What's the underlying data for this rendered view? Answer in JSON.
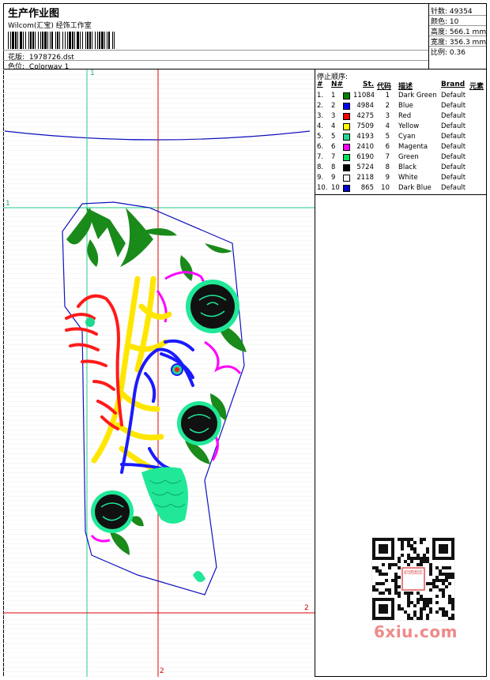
{
  "header": {
    "title": "生产作业图",
    "subtitle": "Wilcom(汇宝) 经饰工作室",
    "design_label": "花版:",
    "design_value": "1978726.dst",
    "colorway_label": "色位:",
    "colorway_value": "Colorway 1"
  },
  "stats": [
    {
      "label": "针数:",
      "value": "49354"
    },
    {
      "label": "颜色:",
      "value": "10"
    },
    {
      "label": "高度:",
      "value": "566.1 mm"
    },
    {
      "label": "宽度:",
      "value": "356.3 mm"
    },
    {
      "label": "比例:",
      "value": "0.36"
    }
  ],
  "sequence": {
    "label": "停止顺序:",
    "columns": [
      "#",
      "N#",
      "St.",
      "代码",
      "描述",
      "Brand",
      "元素"
    ],
    "rows": [
      {
        "num": "1.",
        "n": "1",
        "color": "#008000",
        "st": "11084",
        "code": "1",
        "desc": "Dark Green",
        "brand": "Default"
      },
      {
        "num": "2.",
        "n": "2",
        "color": "#0000ff",
        "st": "4984",
        "code": "2",
        "desc": "Blue",
        "brand": "Default"
      },
      {
        "num": "3.",
        "n": "3",
        "color": "#ff0000",
        "st": "4275",
        "code": "3",
        "desc": "Red",
        "brand": "Default"
      },
      {
        "num": "4.",
        "n": "4",
        "color": "#ffff00",
        "st": "7509",
        "code": "4",
        "desc": "Yellow",
        "brand": "Default"
      },
      {
        "num": "5.",
        "n": "5",
        "color": "#20d890",
        "st": "4193",
        "code": "5",
        "desc": "Cyan",
        "brand": "Default"
      },
      {
        "num": "6.",
        "n": "6",
        "color": "#ff00ff",
        "st": "2410",
        "code": "6",
        "desc": "Magenta",
        "brand": "Default"
      },
      {
        "num": "7.",
        "n": "7",
        "color": "#00e060",
        "st": "6190",
        "code": "7",
        "desc": "Green",
        "brand": "Default"
      },
      {
        "num": "8.",
        "n": "8",
        "color": "#000000",
        "st": "5724",
        "code": "8",
        "desc": "Black",
        "brand": "Default"
      },
      {
        "num": "9.",
        "n": "9",
        "color": "#f4f4f0",
        "st": "2118",
        "code": "9",
        "desc": "White",
        "brand": "Default"
      },
      {
        "num": "10.",
        "n": "10",
        "color": "#0000c8",
        "st": "865",
        "code": "10",
        "desc": "Dark Blue",
        "brand": "Default"
      }
    ]
  },
  "guides": {
    "green": "1",
    "red": "2"
  },
  "watermark": "6xiu.com",
  "qr_stamp": "织绣图库"
}
